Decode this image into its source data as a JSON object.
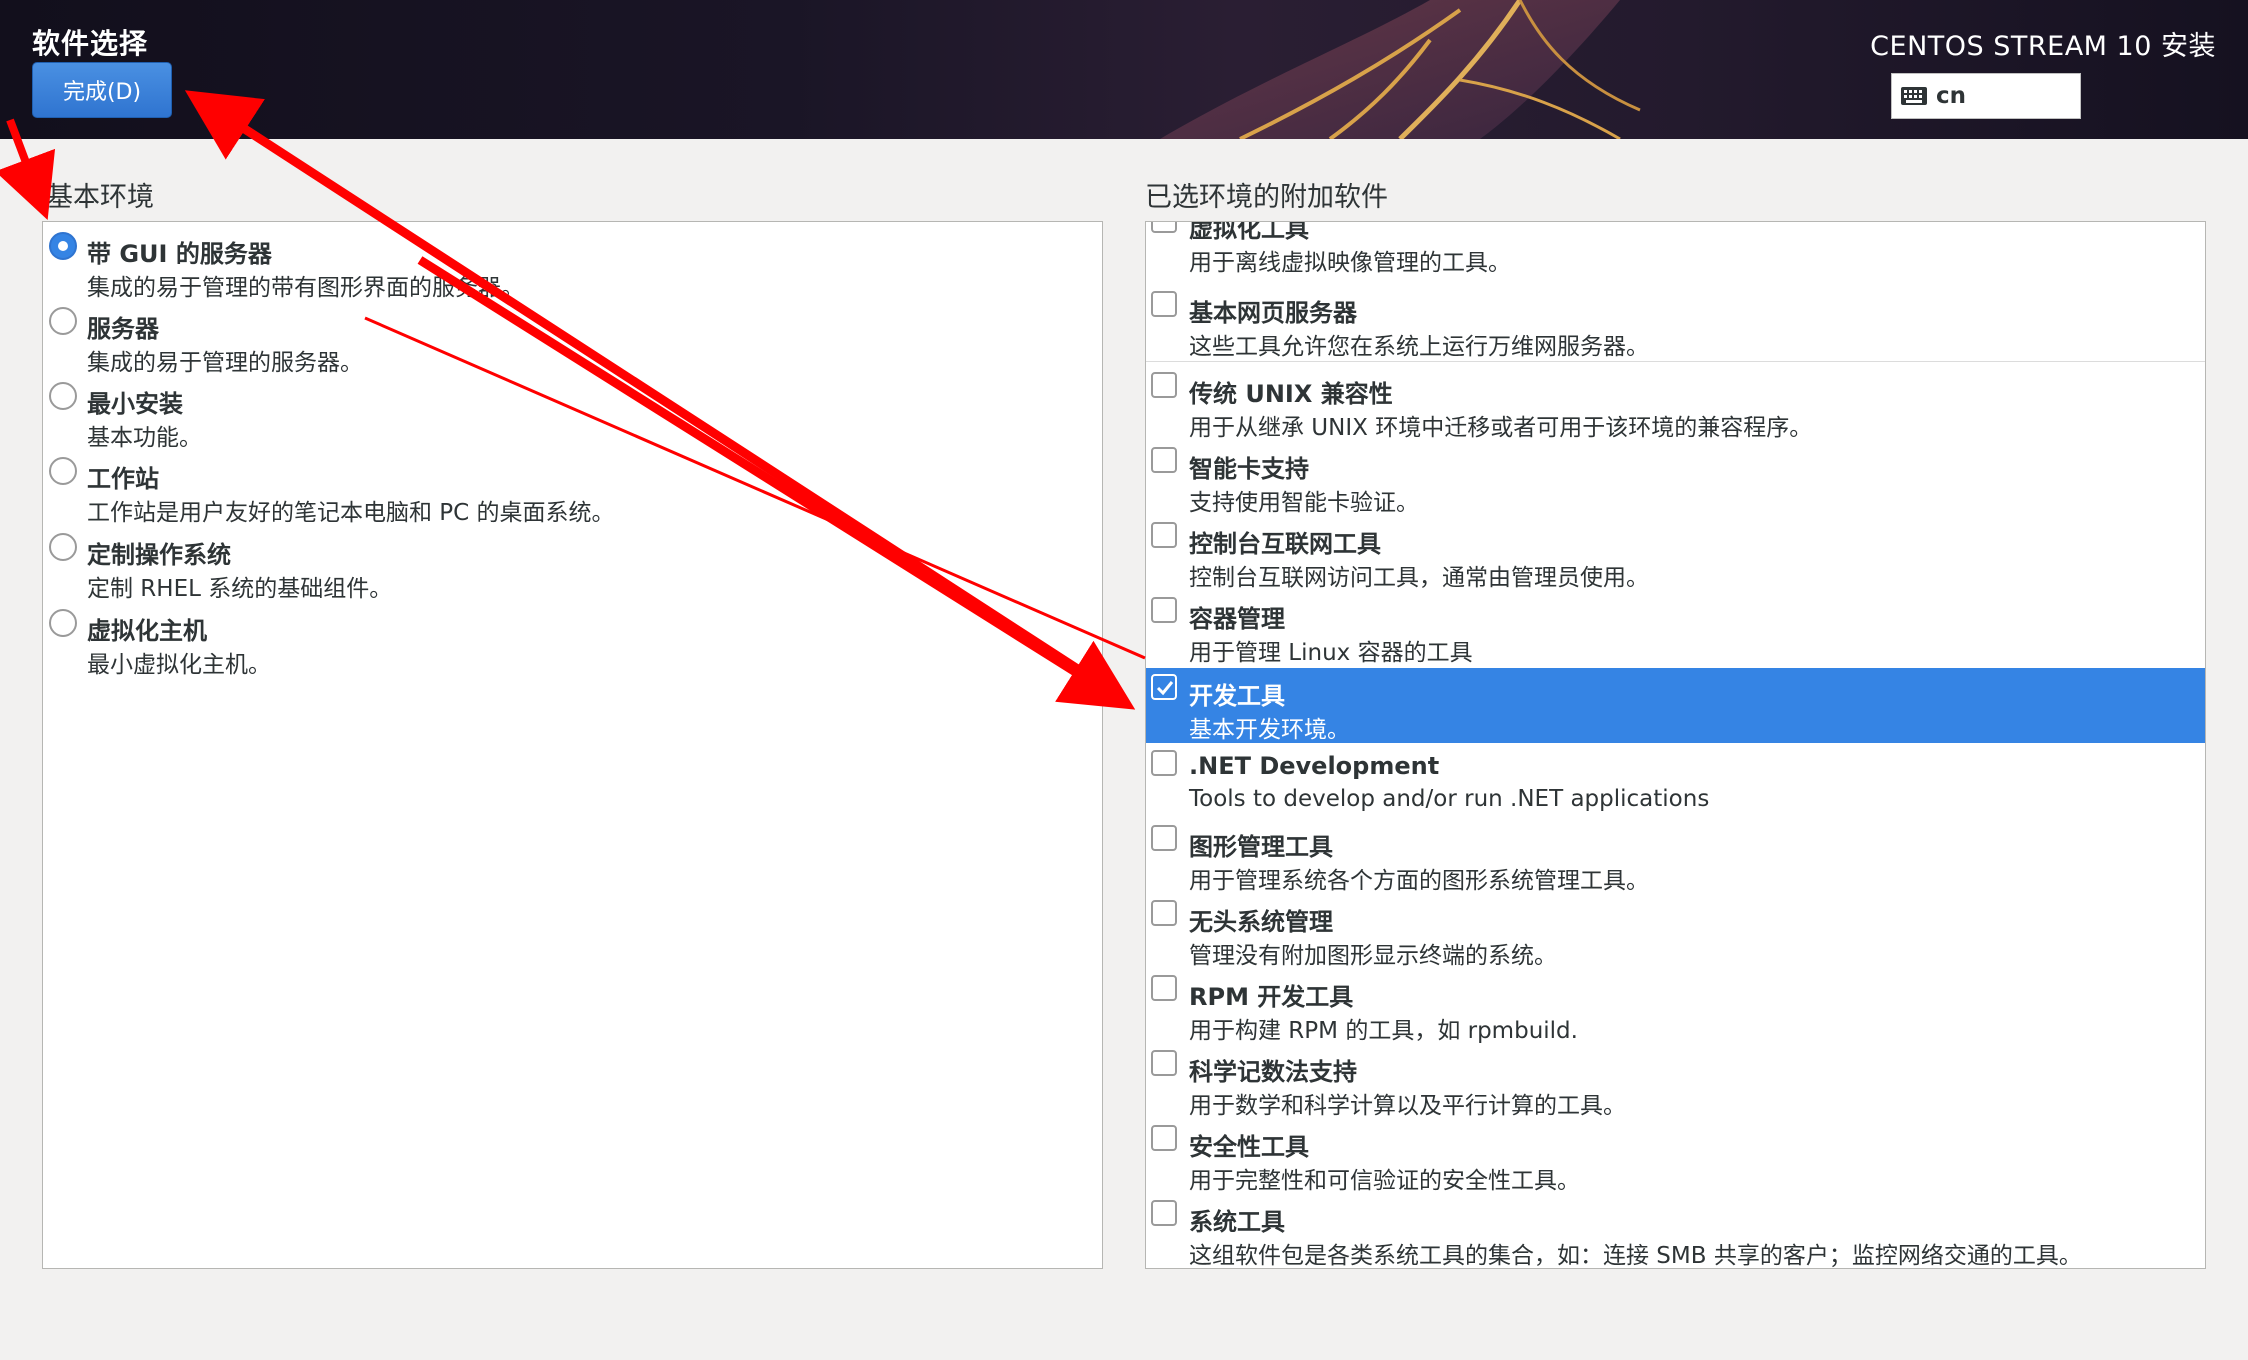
{
  "header": {
    "spoke_title": "软件选择",
    "done_button": "完成(D)",
    "product_title": "CENTOS STREAM 10 安装",
    "keyboard_layout": "cn"
  },
  "base_env": {
    "label": "基本环境",
    "items": [
      {
        "name": "带 GUI 的服务器",
        "desc": "集成的易于管理的带有图形界面的服务器。",
        "selected": true
      },
      {
        "name": "服务器",
        "desc": "集成的易于管理的服务器。",
        "selected": false
      },
      {
        "name": "最小安装",
        "desc": "基本功能。",
        "selected": false
      },
      {
        "name": "工作站",
        "desc": "工作站是用户友好的笔记本电脑和 PC 的桌面系统。",
        "selected": false
      },
      {
        "name": "定制操作系统",
        "desc": "定制 RHEL 系统的基础组件。",
        "selected": false
      },
      {
        "name": "虚拟化主机",
        "desc": "最小虚拟化主机。",
        "selected": false
      }
    ]
  },
  "addons": {
    "label": "已选环境的附加软件",
    "items": [
      {
        "name": "虚拟化工具",
        "desc": "用于离线虚拟映像管理的工具。",
        "checked": false
      },
      {
        "name": "基本网页服务器",
        "desc": "这些工具允许您在系统上运行万维网服务器。",
        "checked": false
      },
      {
        "name": "传统 UNIX 兼容性",
        "desc": "用于从继承 UNIX 环境中迁移或者可用于该环境的兼容程序。",
        "checked": false
      },
      {
        "name": "智能卡支持",
        "desc": "支持使用智能卡验证。",
        "checked": false
      },
      {
        "name": "控制台互联网工具",
        "desc": "控制台互联网访问工具，通常由管理员使用。",
        "checked": false
      },
      {
        "name": "容器管理",
        "desc": "用于管理 Linux 容器的工具",
        "checked": false
      },
      {
        "name": "开发工具",
        "desc": "基本开发环境。",
        "checked": true
      },
      {
        "name": ".NET Development",
        "desc": "Tools to develop and/or run .NET applications",
        "checked": false
      },
      {
        "name": "图形管理工具",
        "desc": "用于管理系统各个方面的图形系统管理工具。",
        "checked": false
      },
      {
        "name": "无头系统管理",
        "desc": "管理没有附加图形显示终端的系统。",
        "checked": false
      },
      {
        "name": "RPM 开发工具",
        "desc": "用于构建 RPM 的工具，如 rpmbuild.",
        "checked": false
      },
      {
        "name": "科学记数法支持",
        "desc": "用于数学和科学计算以及平行计算的工具。",
        "checked": false
      },
      {
        "name": "安全性工具",
        "desc": "用于完整性和可信验证的安全性工具。",
        "checked": false
      },
      {
        "name": "系统工具",
        "desc": "这组软件包是各类系统工具的集合，如：连接 SMB 共享的客户；监控网络交通的工具。",
        "checked": false
      }
    ]
  },
  "colors": {
    "accent": "#3584e4",
    "annotation": "#ff0000"
  }
}
